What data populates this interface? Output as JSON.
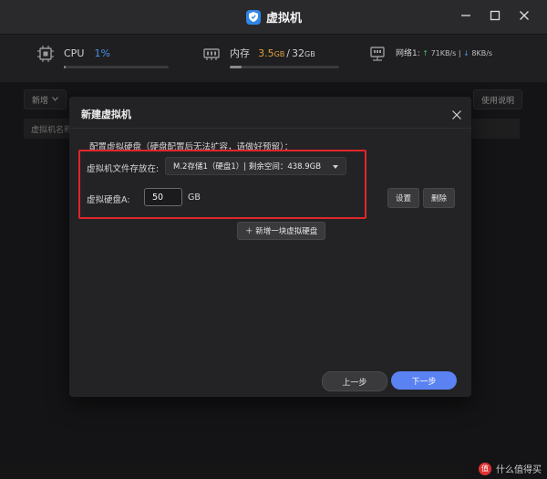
{
  "app": {
    "title": "虚拟机",
    "logo_icon": "shield-icon"
  },
  "window_controls": [
    "minimize-icon",
    "maximize-icon",
    "close-icon"
  ],
  "stats": {
    "cpu": {
      "label": "CPU",
      "value": "1%",
      "usage_fraction": 0.01,
      "color": "#4a90e2"
    },
    "memory": {
      "label": "内存",
      "used": "3.5",
      "used_unit": "GB",
      "separator": "/",
      "total": "32",
      "total_unit": "GB",
      "usage_fraction": 0.11,
      "color": "#e0a23a"
    },
    "network": {
      "label": "网络1:",
      "up_arrow": "↑",
      "up": "71KB/s",
      "sep": "|",
      "down_arrow": "↓",
      "down": "8KB/s"
    }
  },
  "toolbar": {
    "new_label": "新增",
    "help_label": "使用说明"
  },
  "table": {
    "col_name": "虚拟机名称"
  },
  "dialog": {
    "title": "新建虚拟机",
    "section_label": "配置虚拟硬盘（硬盘配置后无法扩容，请做好预留）：",
    "storage_label": "虚拟机文件存放在:",
    "storage_value": "M.2存储1（硬盘1）| 剩余空间：438.9GB",
    "disk_label": "虚拟硬盘A:",
    "disk_value": "50",
    "disk_unit": "GB",
    "settings_label": "设置",
    "delete_label": "删除",
    "add_disk_label": "＋ 新增一块虚拟硬盘",
    "prev_label": "上一步",
    "next_label": "下一步"
  },
  "footer": {
    "badge": "值",
    "text": "什么值得买"
  },
  "colors": {
    "accent": "#5b82f2",
    "highlight": "#e0262b",
    "up": "#4fbf72",
    "down": "#4a8fe0"
  }
}
